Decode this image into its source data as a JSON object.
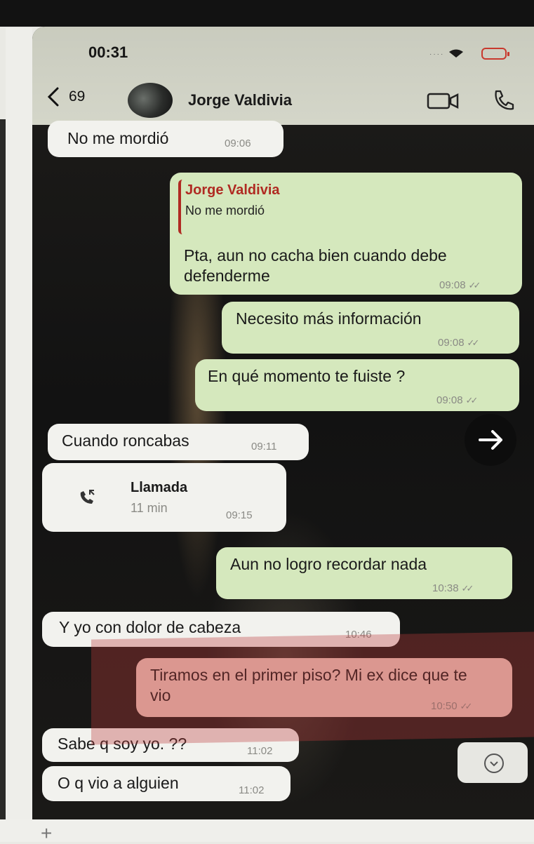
{
  "status_bar": {
    "time": "00:31"
  },
  "header": {
    "back_count": "69",
    "contact_name": "Jorge Valdivia"
  },
  "messages": [
    {
      "text": "No me mordió",
      "time": "09:06"
    },
    {
      "reply_name": "Jorge Valdivia",
      "reply_text": "No me mordió",
      "text": "Pta, aun no cacha bien cuando debe defenderme",
      "time": "09:08"
    },
    {
      "text": "Necesito más información",
      "time": "09:08"
    },
    {
      "text": "En qué momento te fuiste ?",
      "time": "09:08"
    },
    {
      "text": "Cuando roncabas",
      "time": "09:11"
    },
    {
      "call_title": "Llamada",
      "call_duration": "11 min",
      "time": "09:15"
    },
    {
      "text": "Aun no logro recordar nada",
      "time": "10:38"
    },
    {
      "text": "Y yo con dolor de cabeza",
      "time": "10:46"
    },
    {
      "text": "Tiramos en el primer piso? Mi ex dice que te vio",
      "time": "10:50"
    },
    {
      "text": "Sabe q soy yo. ??",
      "time": "11:02"
    },
    {
      "text": "O q vio a alguien",
      "time": "11:02"
    }
  ],
  "icons": {
    "back": "chevron-left-icon",
    "video": "video-camera-icon",
    "phone": "phone-icon",
    "call": "missed-call-icon",
    "forward": "arrow-right-icon",
    "scroll_down": "chevron-down-icon",
    "attach": "plus-icon"
  },
  "colors": {
    "quote_accent": "#b02a22",
    "outgoing_bubble": "#d5e8bd",
    "incoming_bubble": "#f2f2ee",
    "highlight": "#ecc8bd"
  }
}
